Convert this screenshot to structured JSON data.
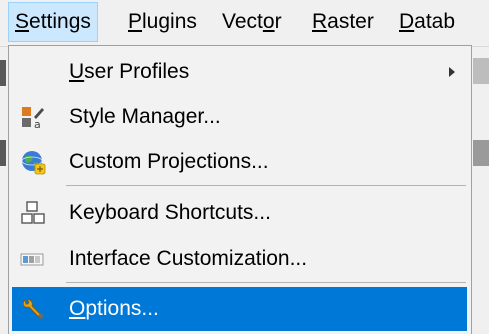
{
  "menubar": {
    "items": [
      {
        "label_pre": "",
        "label_ul": "S",
        "label_post": "ettings",
        "active": true
      },
      {
        "label_pre": "",
        "label_ul": "P",
        "label_post": "lugins",
        "active": false
      },
      {
        "label_pre": "Vect",
        "label_ul": "o",
        "label_post": "r",
        "active": false
      },
      {
        "label_pre": "",
        "label_ul": "R",
        "label_post": "aster",
        "active": false
      },
      {
        "label_pre": "",
        "label_ul": "D",
        "label_post": "atab",
        "active": false
      }
    ]
  },
  "dropdown": {
    "items": [
      {
        "label_pre": "",
        "label_ul": "U",
        "label_post": "ser Profiles",
        "icon": "none",
        "has_submenu": true,
        "selected": false
      },
      {
        "label_pre": "",
        "label_ul": "",
        "label_post": "Style Manager...",
        "icon": "style-manager-icon",
        "has_submenu": false,
        "selected": false
      },
      {
        "label_pre": "",
        "label_ul": "",
        "label_post": "Custom Projections...",
        "icon": "globe-icon",
        "has_submenu": false,
        "selected": false
      },
      {
        "label_pre": "",
        "label_ul": "",
        "label_post": "Keyboard Shortcuts...",
        "icon": "keyboard-shortcuts-icon",
        "has_submenu": false,
        "selected": false
      },
      {
        "label_pre": "",
        "label_ul": "",
        "label_post": "Interface Customization...",
        "icon": "interface-customization-icon",
        "has_submenu": false,
        "selected": false
      },
      {
        "label_pre": "",
        "label_ul": "O",
        "label_post": "ptions...",
        "icon": "wrench-icon",
        "has_submenu": false,
        "selected": true
      }
    ]
  },
  "colors": {
    "selection": "#0078d7",
    "menubar_active_bg": "#cce8ff",
    "menubar_active_border": "#99d1ff",
    "menu_bg": "#f2f2f2"
  }
}
